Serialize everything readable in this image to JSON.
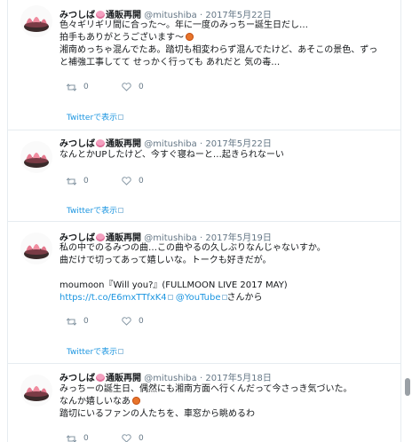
{
  "tweets": [
    {
      "name": "みつしば",
      "shop": "通販再開",
      "handle": "@mitushiba",
      "dot": "·",
      "date": "2017年5月22日",
      "lines": [
        "色々ギリギリ間に合った〜。年に一度のみっちー誕生日だし…",
        "拍手もありがとうございます〜",
        "湘南めっちゃ混んでたあ。踏切も相変わらず混んでたけど、あそこの景色、ずっ",
        "と補強工事してて せっかく行っても あれだと 気の毒…"
      ],
      "retweets": "0",
      "likes": "0",
      "view_label": "Twitterで表示"
    },
    {
      "name": "みつしば",
      "shop": "通販再開",
      "handle": "@mitushiba",
      "dot": "·",
      "date": "2017年5月22日",
      "lines": [
        "なんとかUPしたけど、今すぐ寝ねーと…起きられなーい"
      ],
      "retweets": "0",
      "likes": "0",
      "view_label": "Twitterで表示"
    },
    {
      "name": "みつしば",
      "shop": "通販再開",
      "handle": "@mitushiba",
      "dot": "·",
      "date": "2017年5月19日",
      "lines": [
        "私の中でのるみつの曲…この曲やるの久しぶりなんじゃないすか。",
        "曲だけで切ってあって嬉しいな。トークも好きだが。",
        "",
        "moumoon『Will you?』(FULLMOON LIVE 2017 MAY)"
      ],
      "link_url": "https://t.co/E6mxTTfxK4",
      "link_yt": "@YouTube",
      "link_suffix": "さんから",
      "retweets": "0",
      "likes": "0",
      "view_label": "Twitterで表示"
    },
    {
      "name": "みつしば",
      "shop": "通販再開",
      "handle": "@mitushiba",
      "dot": "·",
      "date": "2017年5月18日",
      "lines": [
        "みっちーの誕生日、偶然にも湘南方面へ行くんだって今さっき気づいた。",
        "なんか嬉しいなあ",
        "踏切にいるファンの人たちを、車窓から眺めるわ"
      ],
      "retweets": "0",
      "likes": "0"
    }
  ],
  "colors": {
    "link": "#1b95e0",
    "muted": "#657786",
    "text": "#14171a",
    "border": "#e6ecf0"
  },
  "icons": {
    "retweet": "retweet-icon",
    "like": "heart-icon",
    "external": "external-link-icon"
  }
}
